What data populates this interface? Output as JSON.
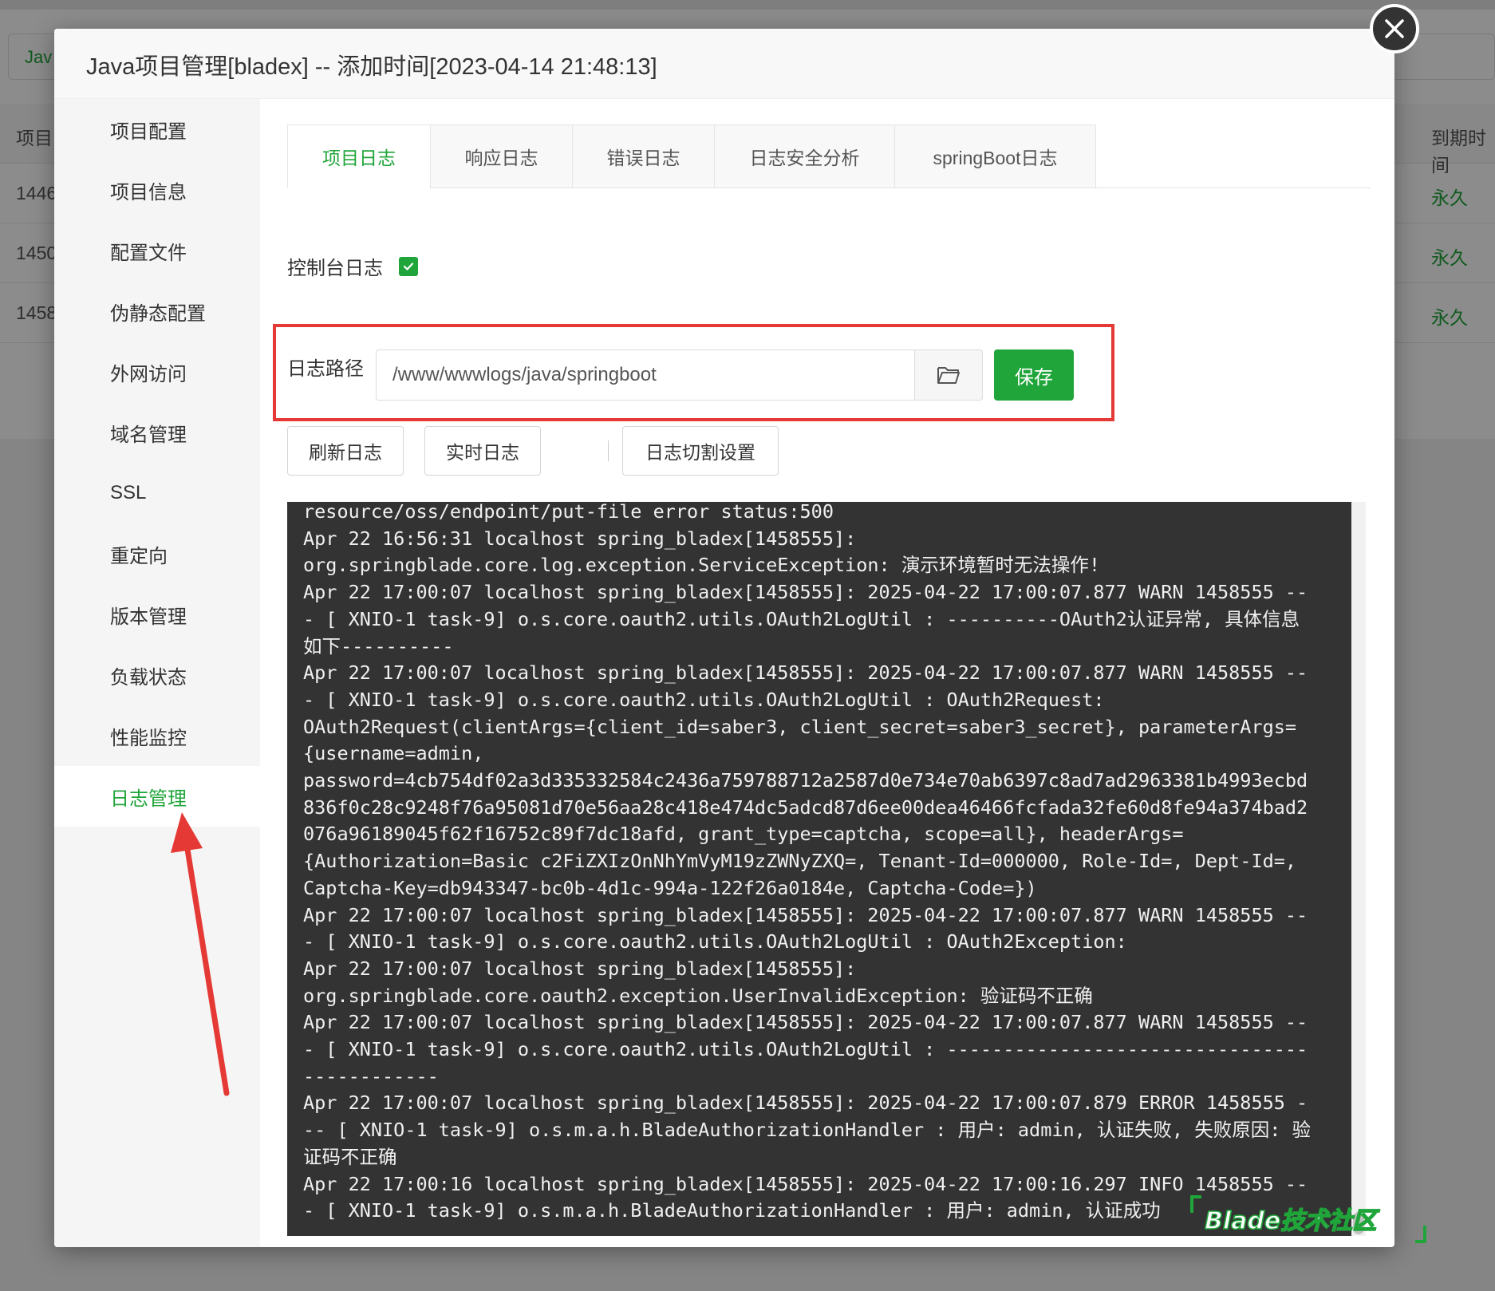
{
  "background": {
    "select_left": "Jav",
    "table_header": {
      "col1": "项目",
      "col_last": "到期时间"
    },
    "rows": [
      {
        "id": "1446",
        "expiry": "永久"
      },
      {
        "id": "1450",
        "expiry": "永久"
      },
      {
        "id": "1458",
        "expiry": "永久"
      }
    ]
  },
  "modal": {
    "title": "Java项目管理[bladex] -- 添加时间[2023-04-14 21:48:13]"
  },
  "sidebar": {
    "items": [
      {
        "label": "项目配置"
      },
      {
        "label": "项目信息"
      },
      {
        "label": "配置文件"
      },
      {
        "label": "伪静态配置"
      },
      {
        "label": "外网访问"
      },
      {
        "label": "域名管理"
      },
      {
        "label": "SSL"
      },
      {
        "label": "重定向"
      },
      {
        "label": "版本管理"
      },
      {
        "label": "负载状态"
      },
      {
        "label": "性能监控"
      },
      {
        "label": "日志管理"
      }
    ],
    "active_index": 11
  },
  "tabs": [
    {
      "label": "项目日志",
      "active": true
    },
    {
      "label": "响应日志"
    },
    {
      "label": "错误日志"
    },
    {
      "label": "日志安全分析"
    },
    {
      "label": "springBoot日志"
    }
  ],
  "console_log": {
    "label": "控制台日志",
    "checked": true
  },
  "log_path": {
    "label": "日志路径",
    "value": "/www/wwwlogs/java/springboot",
    "save_label": "保存"
  },
  "actions": {
    "refresh": "刷新日志",
    "realtime": "实时日志",
    "rotate": "日志切割设置"
  },
  "log_lines": [
    "resource/oss/endpoint/put-file error status:500",
    "Apr 22 16:56:31 localhost spring_bladex[1458555]:",
    "org.springblade.core.log.exception.ServiceException: 演示环境暂时无法操作!",
    "Apr 22 17:00:07 localhost spring_bladex[1458555]: 2025-04-22 17:00:07.877 WARN 1458555 --",
    "- [ XNIO-1 task-9] o.s.core.oauth2.utils.OAuth2LogUtil : ----------OAuth2认证异常, 具体信息",
    "如下----------",
    "Apr 22 17:00:07 localhost spring_bladex[1458555]: 2025-04-22 17:00:07.877 WARN 1458555 --",
    "- [ XNIO-1 task-9] o.s.core.oauth2.utils.OAuth2LogUtil : OAuth2Request:",
    "OAuth2Request(clientArgs={client_id=saber3, client_secret=saber3_secret}, parameterArgs=",
    "{username=admin,",
    "password=4cb754df02a3d335332584c2436a759788712a2587d0e734e70ab6397c8ad7ad2963381b4993ecbd",
    "836f0c28c9248f76a95081d70e56aa28c418e474dc5adcd87d6ee00dea46466fcfada32fe60d8fe94a374bad2",
    "076a96189045f62f16752c89f7dc18afd, grant_type=captcha, scope=all}, headerArgs=",
    "{Authorization=Basic c2FiZXIzOnNhYmVyM19zZWNyZXQ=, Tenant-Id=000000, Role-Id=, Dept-Id=,",
    "Captcha-Key=db943347-bc0b-4d1c-994a-122f26a0184e, Captcha-Code=})",
    "Apr 22 17:00:07 localhost spring_bladex[1458555]: 2025-04-22 17:00:07.877 WARN 1458555 --",
    "- [ XNIO-1 task-9] o.s.core.oauth2.utils.OAuth2LogUtil : OAuth2Exception:",
    "Apr 22 17:00:07 localhost spring_bladex[1458555]:",
    "org.springblade.core.oauth2.exception.UserInvalidException: 验证码不正确",
    "Apr 22 17:00:07 localhost spring_bladex[1458555]: 2025-04-22 17:00:07.877 WARN 1458555 --",
    "- [ XNIO-1 task-9] o.s.core.oauth2.utils.OAuth2LogUtil : --------------------------------",
    "------------",
    "Apr 22 17:00:07 localhost spring_bladex[1458555]: 2025-04-22 17:00:07.879 ERROR 1458555 -",
    "-- [ XNIO-1 task-9] o.s.m.a.h.BladeAuthorizationHandler : 用户: admin, 认证失败, 失败原因: 验",
    "证码不正确",
    "Apr 22 17:00:16 localhost spring_bladex[1458555]: 2025-04-22 17:00:16.297 INFO 1458555 --",
    "- [ XNIO-1 task-9] o.s.m.a.h.BladeAuthorizationHandler : 用户: admin, 认证成功"
  ],
  "watermark": "Blade技术社区",
  "colors": {
    "accent": "#20a53a",
    "highlight": "#e53935",
    "log_bg": "#333333"
  }
}
